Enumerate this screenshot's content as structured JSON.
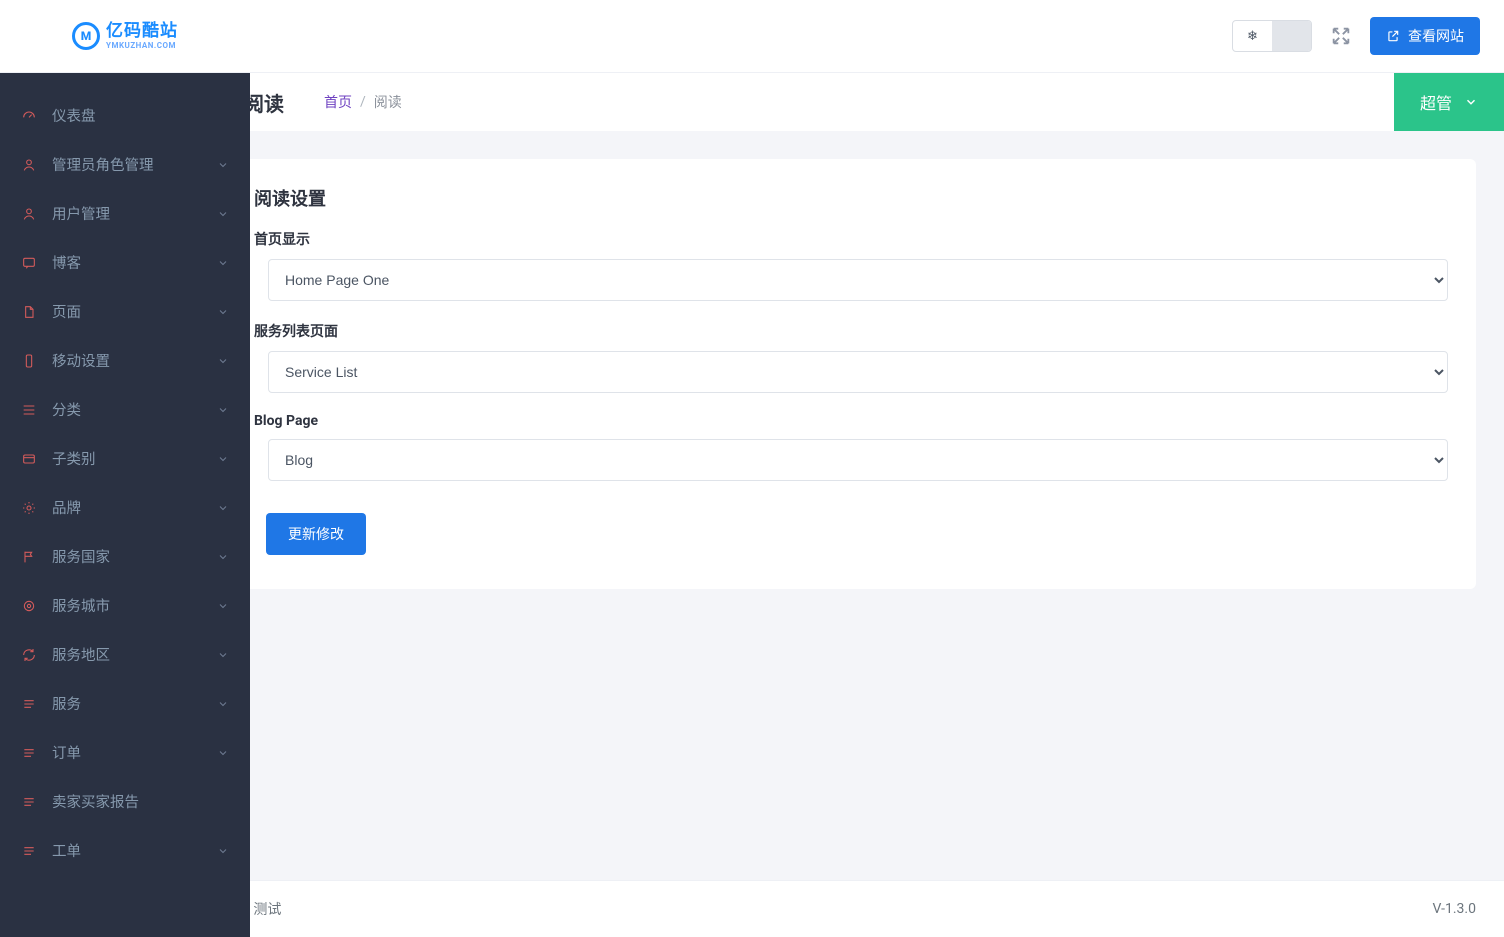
{
  "logo": {
    "cn": "亿码酷站",
    "en": "YMKUZHAN.COM",
    "mark": "M"
  },
  "sidebar": {
    "items": [
      {
        "label": "仪表盘",
        "icon": "gauge-icon",
        "expandable": false
      },
      {
        "label": "管理员角色管理",
        "icon": "user-icon",
        "expandable": true
      },
      {
        "label": "用户管理",
        "icon": "user-icon",
        "expandable": true
      },
      {
        "label": "博客",
        "icon": "message-icon",
        "expandable": true
      },
      {
        "label": "页面",
        "icon": "file-icon",
        "expandable": true
      },
      {
        "label": "移动设置",
        "icon": "mobile-icon",
        "expandable": true
      },
      {
        "label": "分类",
        "icon": "list-icon",
        "expandable": true
      },
      {
        "label": "子类别",
        "icon": "card-icon",
        "expandable": true
      },
      {
        "label": "品牌",
        "icon": "gear-icon",
        "expandable": true
      },
      {
        "label": "服务国家",
        "icon": "flag-icon",
        "expandable": true
      },
      {
        "label": "服务城市",
        "icon": "target-icon",
        "expandable": true
      },
      {
        "label": "服务地区",
        "icon": "refresh-icon",
        "expandable": true
      },
      {
        "label": "服务",
        "icon": "lines-icon",
        "expandable": true
      },
      {
        "label": "订单",
        "icon": "lines-icon",
        "expandable": true
      },
      {
        "label": "卖家买家报告",
        "icon": "lines-icon",
        "expandable": false
      },
      {
        "label": "工单",
        "icon": "lines-icon",
        "expandable": true
      }
    ]
  },
  "topbar": {
    "toggle_on_glyph": "❄",
    "view_site_label": "查看网站"
  },
  "header": {
    "title": "阅读",
    "breadcrumb_home": "首页",
    "breadcrumb_sep": "/",
    "breadcrumb_current": "阅读",
    "role_label": "超管"
  },
  "card": {
    "title": "阅读设置",
    "fields": {
      "home_display": {
        "label": "首页显示",
        "value": "Home Page One"
      },
      "service_list": {
        "label": "服务列表页面",
        "value": "Service List"
      },
      "blog_page": {
        "label": "Blog Page",
        "value": "Blog"
      }
    },
    "submit_label": "更新修改"
  },
  "footer": {
    "left": "- 测试",
    "right": "V-1.3.0"
  }
}
